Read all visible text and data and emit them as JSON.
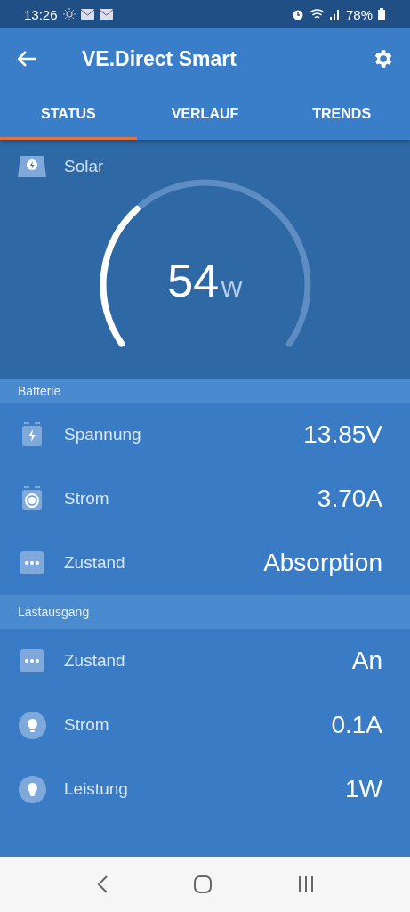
{
  "status_bar": {
    "time": "13:26",
    "battery": "78%"
  },
  "app_bar": {
    "title": "VE.Direct Smart"
  },
  "tabs": [
    {
      "label": "STATUS",
      "selected": true
    },
    {
      "label": "VERLAUF",
      "selected": false
    },
    {
      "label": "TRENDS",
      "selected": false
    }
  ],
  "solar": {
    "label": "Solar",
    "value": "54",
    "unit": "W"
  },
  "sections": [
    {
      "title": "Batterie",
      "rows": [
        {
          "kind": "voltage",
          "label": "Spannung",
          "value": "13.85V"
        },
        {
          "kind": "current",
          "label": "Strom",
          "value": "3.70A"
        },
        {
          "kind": "state",
          "label": "Zustand",
          "value": "Absorption"
        }
      ]
    },
    {
      "title": "Lastausgang",
      "rows": [
        {
          "kind": "state",
          "label": "Zustand",
          "value": "An"
        },
        {
          "kind": "load",
          "label": "Strom",
          "value": "0.1A"
        },
        {
          "kind": "load",
          "label": "Leistung",
          "value": "1W"
        }
      ]
    }
  ]
}
